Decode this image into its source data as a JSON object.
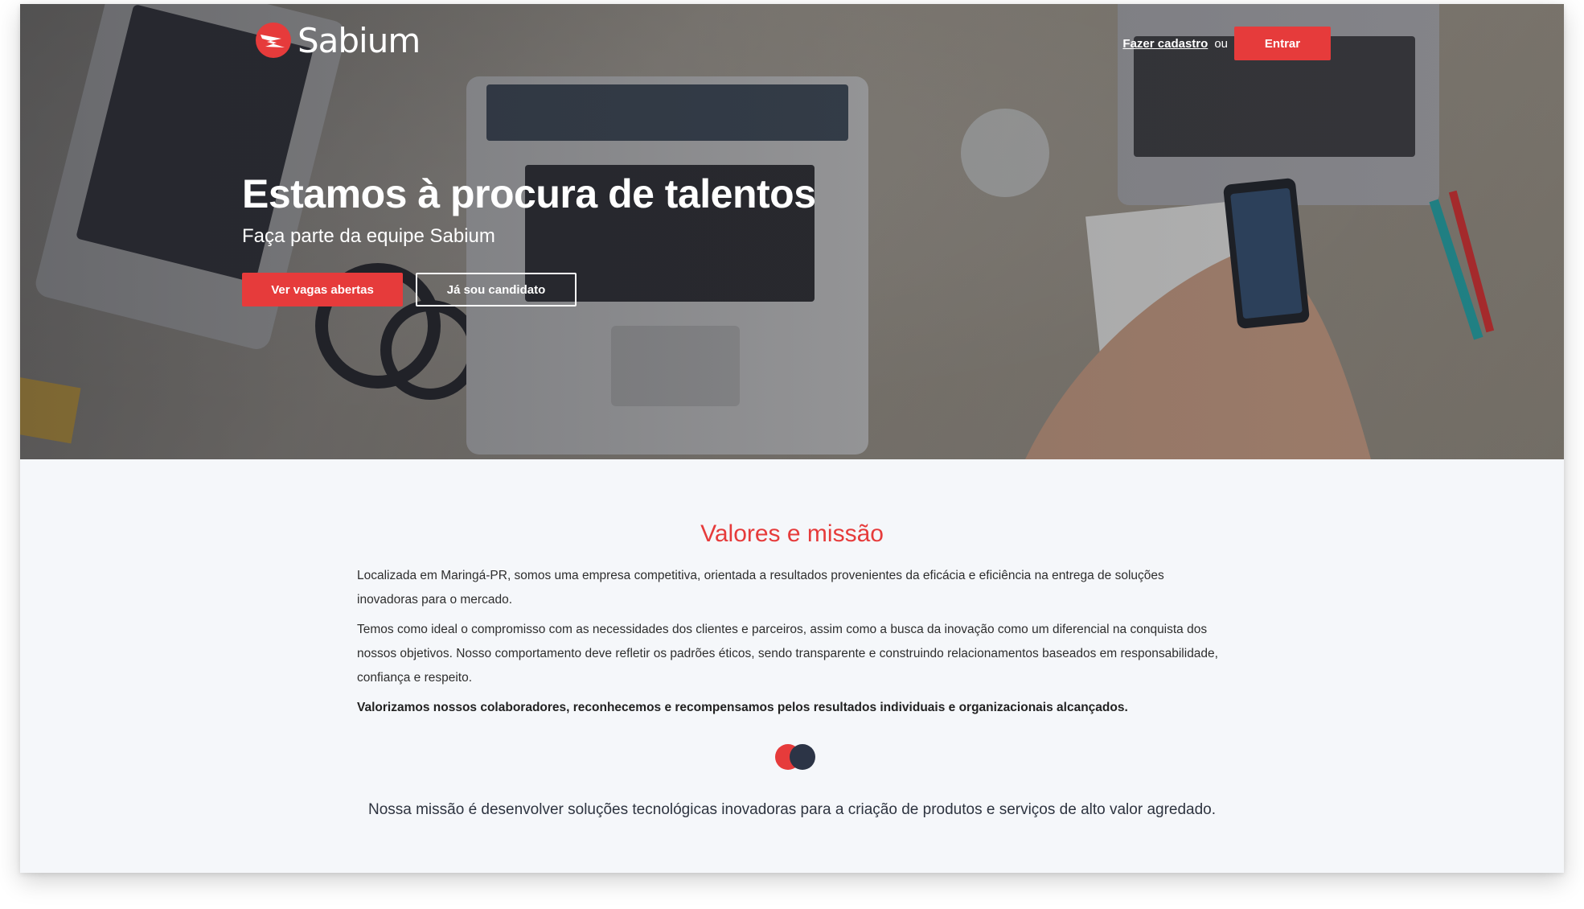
{
  "brand": {
    "name": "Sabium",
    "accent_color": "#e63b3b",
    "dark_color": "#2c3446",
    "logo_icon": "sabium-logo-mark-icon"
  },
  "nav": {
    "signup_link": "Fazer cadastro",
    "or_text": "ou",
    "login_button": "Entrar"
  },
  "hero": {
    "title": "Estamos à procura de talentos",
    "subtitle": "Faça parte da equipe Sabium",
    "primary_button": "Ver vagas abertas",
    "secondary_button": "Já sou candidato",
    "background": "desk-with-laptops-photo"
  },
  "values": {
    "title": "Valores e missão",
    "paragraphs": [
      "Localizada em Maringá-PR, somos uma empresa competitiva, orientada a resultados provenientes da eficácia e eficiência na entrega de soluções inovadoras para o mercado.",
      "Temos como ideal o compromisso com as necessidades dos clientes e parceiros, assim como a busca da inovação como um diferencial na conquista dos nossos objetivos. Nosso comportamento deve refletir os padrões éticos, sendo transparente e construindo relacionamentos baseados em responsabilidade, confiança e respeito.",
      "Valorizamos nossos colaboradores, reconhecemos e recompensamos pelos resultados individuais e organizacionais alcançados."
    ],
    "mission": "Nossa missão é desenvolver soluções tecnológicas inovadoras para a criação de produtos e serviços de alto valor agredado."
  }
}
